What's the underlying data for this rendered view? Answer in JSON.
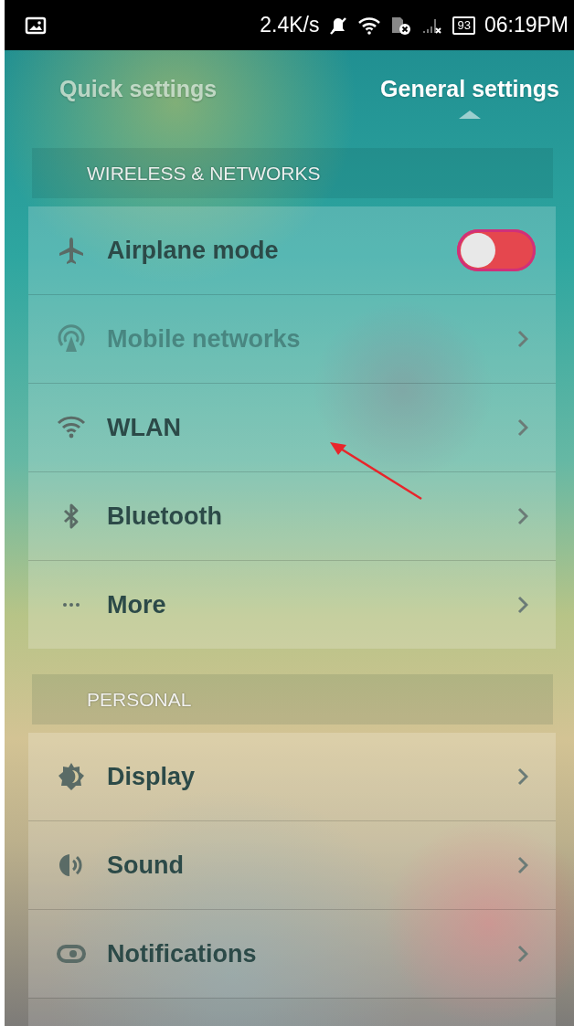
{
  "status_bar": {
    "speed": "2.4K/s",
    "battery": "93",
    "time": "06:19PM"
  },
  "tabs": [
    {
      "label": "Quick settings",
      "selected": false
    },
    {
      "label": "General settings",
      "selected": true
    }
  ],
  "sections": [
    {
      "header": "WIRELESS & NETWORKS",
      "items": [
        {
          "kind": "toggle",
          "label": "Airplane mode",
          "on": false,
          "disabled": false
        },
        {
          "kind": "link",
          "label": "Mobile networks",
          "disabled": true
        },
        {
          "kind": "link",
          "label": "WLAN",
          "disabled": false
        },
        {
          "kind": "link",
          "label": "Bluetooth",
          "disabled": false
        },
        {
          "kind": "link",
          "label": "More",
          "disabled": false
        }
      ]
    },
    {
      "header": "PERSONAL",
      "items": [
        {
          "kind": "link",
          "label": "Display",
          "disabled": false
        },
        {
          "kind": "link",
          "label": "Sound",
          "disabled": false
        },
        {
          "kind": "link",
          "label": "Notifications",
          "disabled": false
        }
      ]
    }
  ]
}
